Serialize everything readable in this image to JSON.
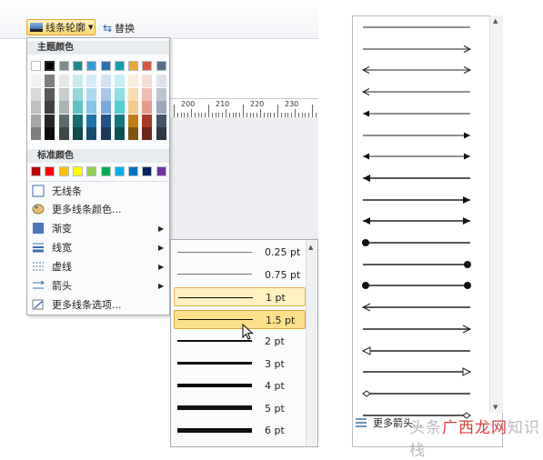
{
  "toolbar": {
    "outline_label": "线条轮廓",
    "replace_label": "替换"
  },
  "ruler": {
    "labels": [
      "200",
      "210",
      "220",
      "230"
    ]
  },
  "menu": {
    "theme_colors_header": "主题颜色",
    "standard_colors_header": "标准颜色",
    "theme_top_row": [
      "#ffffff",
      "#000000",
      "#7f8c8d",
      "#1f8a8a",
      "#3b9bd6",
      "#2e6fb5",
      "#17a0a8",
      "#e9a63c",
      "#d9543e",
      "#5a6f86"
    ],
    "theme_columns": [
      [
        "#f2f2f2",
        "#d9d9d9",
        "#bfbfbf",
        "#a6a6a6",
        "#7f7f7f"
      ],
      [
        "#7f7f7f",
        "#595959",
        "#404040",
        "#262626",
        "#0d0d0d"
      ],
      [
        "#e3e6e6",
        "#c7cdcd",
        "#aab4b4",
        "#5e6b6b",
        "#3f4848"
      ],
      [
        "#c8ecec",
        "#92d8d8",
        "#5bc4c4",
        "#167070",
        "#0e4b4b"
      ],
      [
        "#d6ebf8",
        "#addaf1",
        "#84c8ea",
        "#1e74a8",
        "#144e70"
      ],
      [
        "#d2e2f3",
        "#a6c5e7",
        "#79a8dc",
        "#225388",
        "#17375b"
      ],
      [
        "#c5eff1",
        "#8bdfe3",
        "#51cfd5",
        "#11787e",
        "#0c5054"
      ],
      [
        "#fbeed8",
        "#f7dcb1",
        "#f3cb8a",
        "#c17e16",
        "#81540f"
      ],
      [
        "#f7ddd8",
        "#efbbb2",
        "#e8998b",
        "#a83a26",
        "#70271a"
      ],
      [
        "#dde2e8",
        "#bcc5d0",
        "#9ca9b9",
        "#435466",
        "#2d3844"
      ]
    ],
    "standard_colors": [
      "#c00000",
      "#ff0000",
      "#ffc000",
      "#ffff00",
      "#92d050",
      "#00b050",
      "#00b0f0",
      "#0070c0",
      "#002060",
      "#7030a0"
    ],
    "items": [
      {
        "label": "无线条",
        "icon": "no-line-icon",
        "arrow": false
      },
      {
        "label": "更多线条颜色...",
        "icon": "palette-icon",
        "arrow": false
      },
      {
        "label": "渐变",
        "icon": "gradient-icon",
        "arrow": true
      },
      {
        "label": "线宽",
        "icon": "line-width-icon",
        "arrow": true
      },
      {
        "label": "虚线",
        "icon": "dash-icon",
        "arrow": true
      },
      {
        "label": "箭头",
        "icon": "arrow-icon",
        "arrow": true
      },
      {
        "label": "更多线条选项...",
        "icon": "line-options-icon",
        "arrow": false
      }
    ]
  },
  "width_menu": {
    "items": [
      {
        "label": "0.25 pt",
        "thickness": 0.25
      },
      {
        "label": "0.75 pt",
        "thickness": 0.75
      },
      {
        "label": "1 pt",
        "thickness": 1
      },
      {
        "label": "1.5 pt",
        "thickness": 1.5
      },
      {
        "label": "2 pt",
        "thickness": 2
      },
      {
        "label": "3 pt",
        "thickness": 3
      },
      {
        "label": "4 pt",
        "thickness": 4
      },
      {
        "label": "5 pt",
        "thickness": 5
      },
      {
        "label": "6 pt",
        "thickness": 6
      }
    ],
    "hovered_index": 2,
    "selected_index": 3
  },
  "arrow_panel": {
    "styles": [
      {
        "start": "none",
        "end": "none"
      },
      {
        "start": "none",
        "end": "open"
      },
      {
        "start": "open",
        "end": "open"
      },
      {
        "start": "open",
        "end": "none"
      },
      {
        "start": "filled",
        "end": "none"
      },
      {
        "start": "none",
        "end": "filled"
      },
      {
        "start": "filled",
        "end": "filled"
      },
      {
        "start": "filled",
        "end": "none"
      },
      {
        "start": "none",
        "end": "filled"
      },
      {
        "start": "filled",
        "end": "filled"
      },
      {
        "start": "dot",
        "end": "none"
      },
      {
        "start": "none",
        "end": "dot"
      },
      {
        "start": "dot",
        "end": "dot"
      },
      {
        "start": "open",
        "end": "none"
      },
      {
        "start": "none",
        "end": "open"
      },
      {
        "start": "hollow",
        "end": "none"
      },
      {
        "start": "none",
        "end": "hollow"
      },
      {
        "start": "diamond",
        "end": "none"
      },
      {
        "start": "none",
        "end": "diamond"
      }
    ],
    "more_label": "更多箭头..."
  },
  "watermark": {
    "part1": "头条",
    "part2": "广西龙网",
    "part3": "知识栈"
  }
}
